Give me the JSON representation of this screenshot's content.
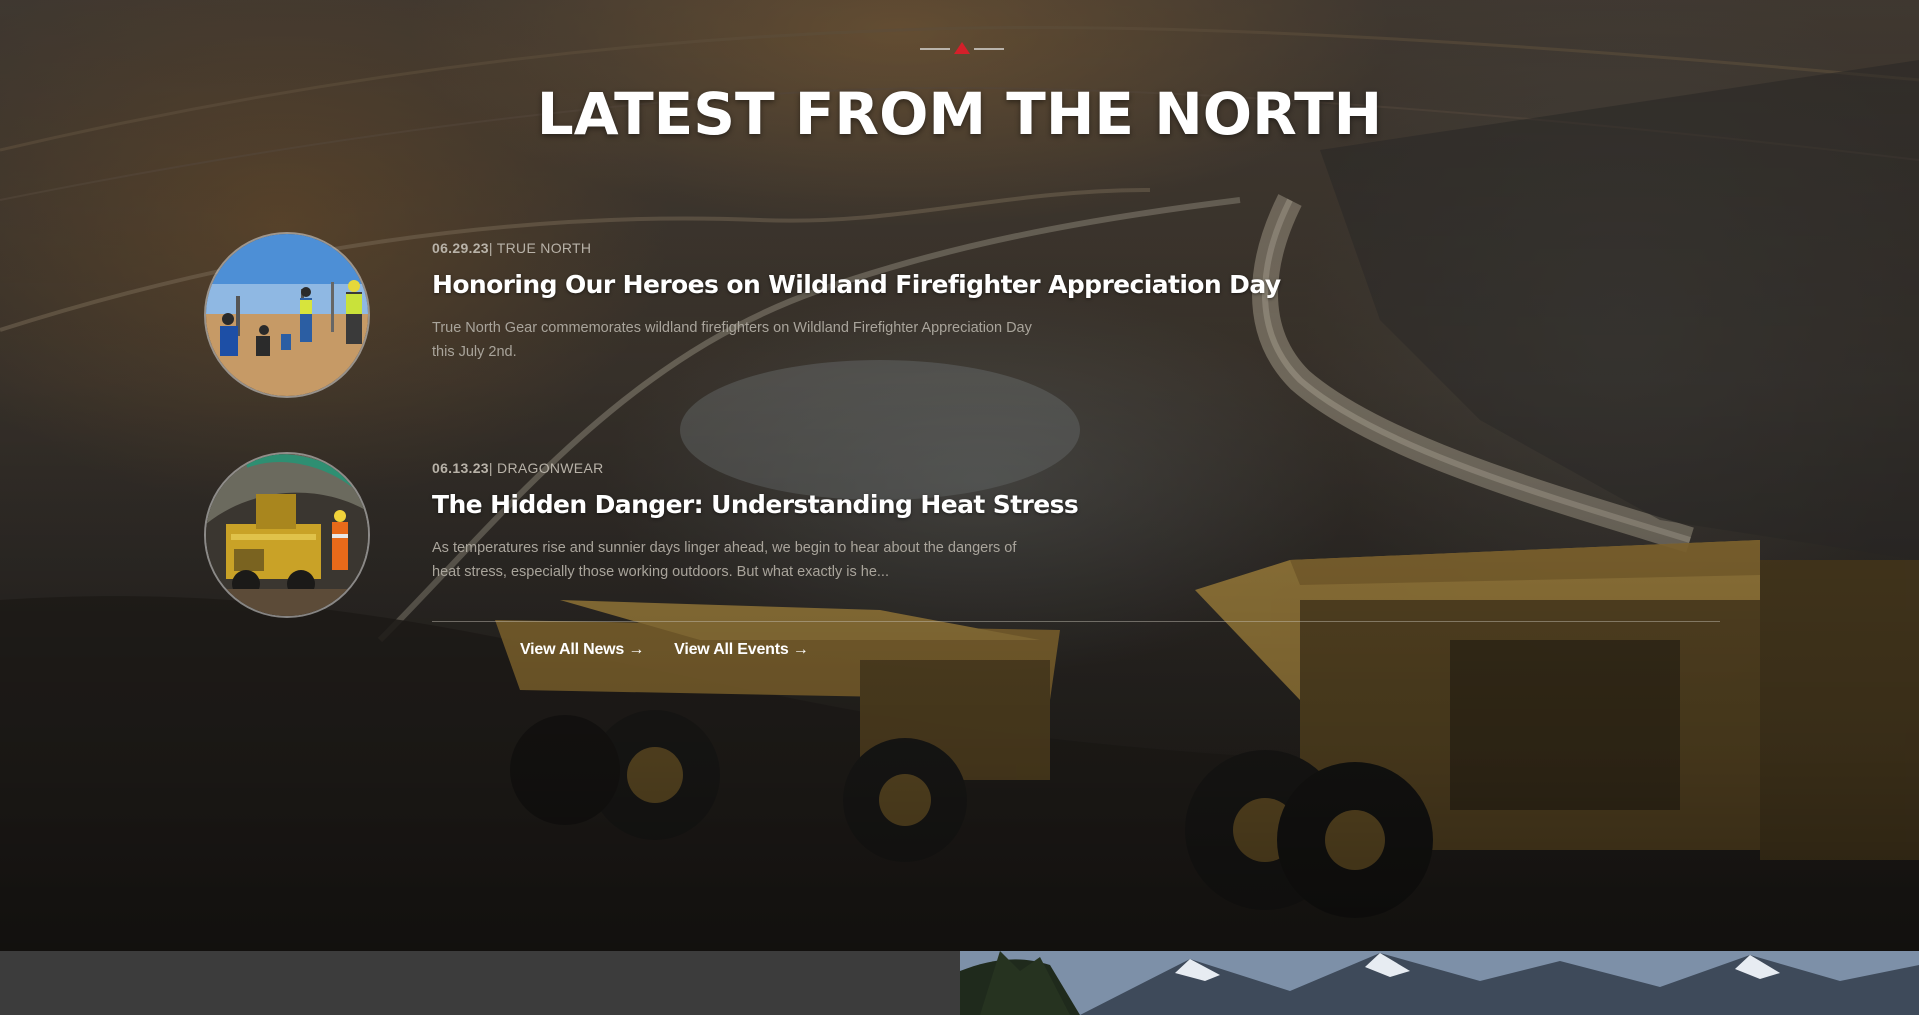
{
  "section": {
    "title": "LATEST FROM THE NORTH",
    "accent_color": "#d4202a"
  },
  "posts": [
    {
      "date": "06.29.23",
      "category": "TRUE NORTH",
      "separator": "|",
      "title": "Honoring Our Heroes on Wildland Firefighter Appreciation Day",
      "excerpt": "True North Gear commemorates wildland firefighters on Wildland Firefighter Appreciation Day this July 2nd.",
      "image_icon": "field-workers-photo"
    },
    {
      "date": "06.13.23",
      "category": "DRAGONWEAR",
      "separator": "|",
      "title": "The Hidden Danger: Understanding Heat Stress",
      "excerpt": "As temperatures rise and sunnier days linger ahead, we begin to hear about the dangers of heat stress, especially those working outdoors. But what exactly is he...",
      "image_icon": "mining-machine-photo"
    }
  ],
  "links": {
    "news": "View All News →",
    "events": "View All Events →"
  }
}
